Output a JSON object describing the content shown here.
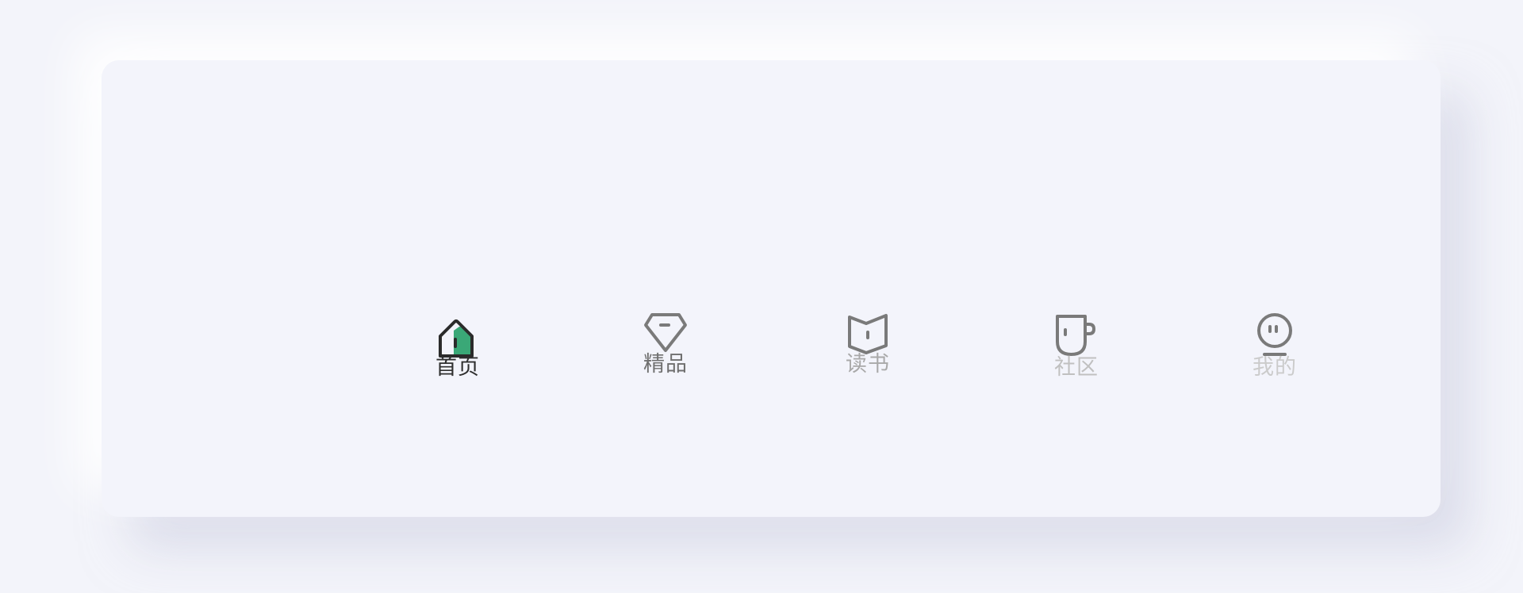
{
  "nav": {
    "items": [
      {
        "id": "home",
        "label": "首页",
        "icon": "house-icon",
        "active": true
      },
      {
        "id": "featured",
        "label": "精品",
        "icon": "diamond-icon",
        "active": false
      },
      {
        "id": "read",
        "label": "读书",
        "icon": "book-icon",
        "active": false
      },
      {
        "id": "community",
        "label": "社区",
        "icon": "mug-icon",
        "active": false
      },
      {
        "id": "mine",
        "label": "我的",
        "icon": "profile-face-icon",
        "active": false
      }
    ]
  },
  "colors": {
    "background": "#f3f4fa",
    "card": "#f3f4fb",
    "accent": "#3aa877",
    "icon_active": "#2b2b2b",
    "icon_inactive": "#7a7a7a",
    "label_active": "#2f2f2f"
  }
}
